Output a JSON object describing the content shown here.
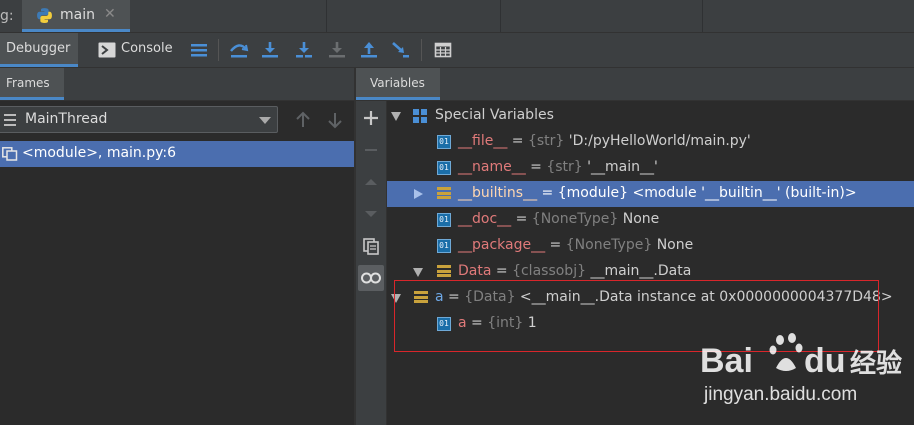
{
  "tabbar": {
    "prefix": "g:",
    "file_tab": "main",
    "close": "✕"
  },
  "toolbar": {
    "debugger": "Debugger",
    "console": "Console",
    "icons": [
      "threads-icon",
      "step-over-icon",
      "step-into-icon",
      "step-into-my-code-icon",
      "force-step-into-icon",
      "step-out-icon",
      "run-to-cursor-icon",
      "evaluate-expression-icon"
    ]
  },
  "frames": {
    "header": "Frames",
    "thread": "MainThread",
    "frame": "<module>, main.py:6"
  },
  "variables": {
    "header": "Variables",
    "rows": [
      {
        "name": "Special Variables",
        "type": "",
        "value": ""
      },
      {
        "name": "__file__",
        "eq": " = ",
        "type": "{str}",
        "value": " 'D:/pyHelloWorld/main.py'"
      },
      {
        "name": "__name__",
        "eq": " = ",
        "type": "{str}",
        "value": " '__main__'"
      },
      {
        "name": "__builtins__",
        "eq": " = ",
        "type": "{module}",
        "value": " <module '__builtin__' (built-in)>"
      },
      {
        "name": "__doc__",
        "eq": " = ",
        "type": "{NoneType}",
        "value": " None"
      },
      {
        "name": "__package__",
        "eq": " = ",
        "type": "{NoneType}",
        "value": " None"
      },
      {
        "name": "Data",
        "eq": " = ",
        "type": "{classobj}",
        "value": " __main__.Data"
      },
      {
        "name": "a",
        "eq": " = ",
        "type": "{Data}",
        "value": " <__main__.Data instance at 0x0000000004377D48>"
      },
      {
        "name": "a",
        "eq": " = ",
        "type": "{int}",
        "value": " 1"
      }
    ]
  },
  "watermark": {
    "brand": "Bai",
    "brand2": "du",
    "cn": "经验",
    "url": "jingyan.baidu.com"
  },
  "colors": {
    "accent": "#4a88c7",
    "selection": "#4b6eaf",
    "highlight": "#d9262b"
  }
}
